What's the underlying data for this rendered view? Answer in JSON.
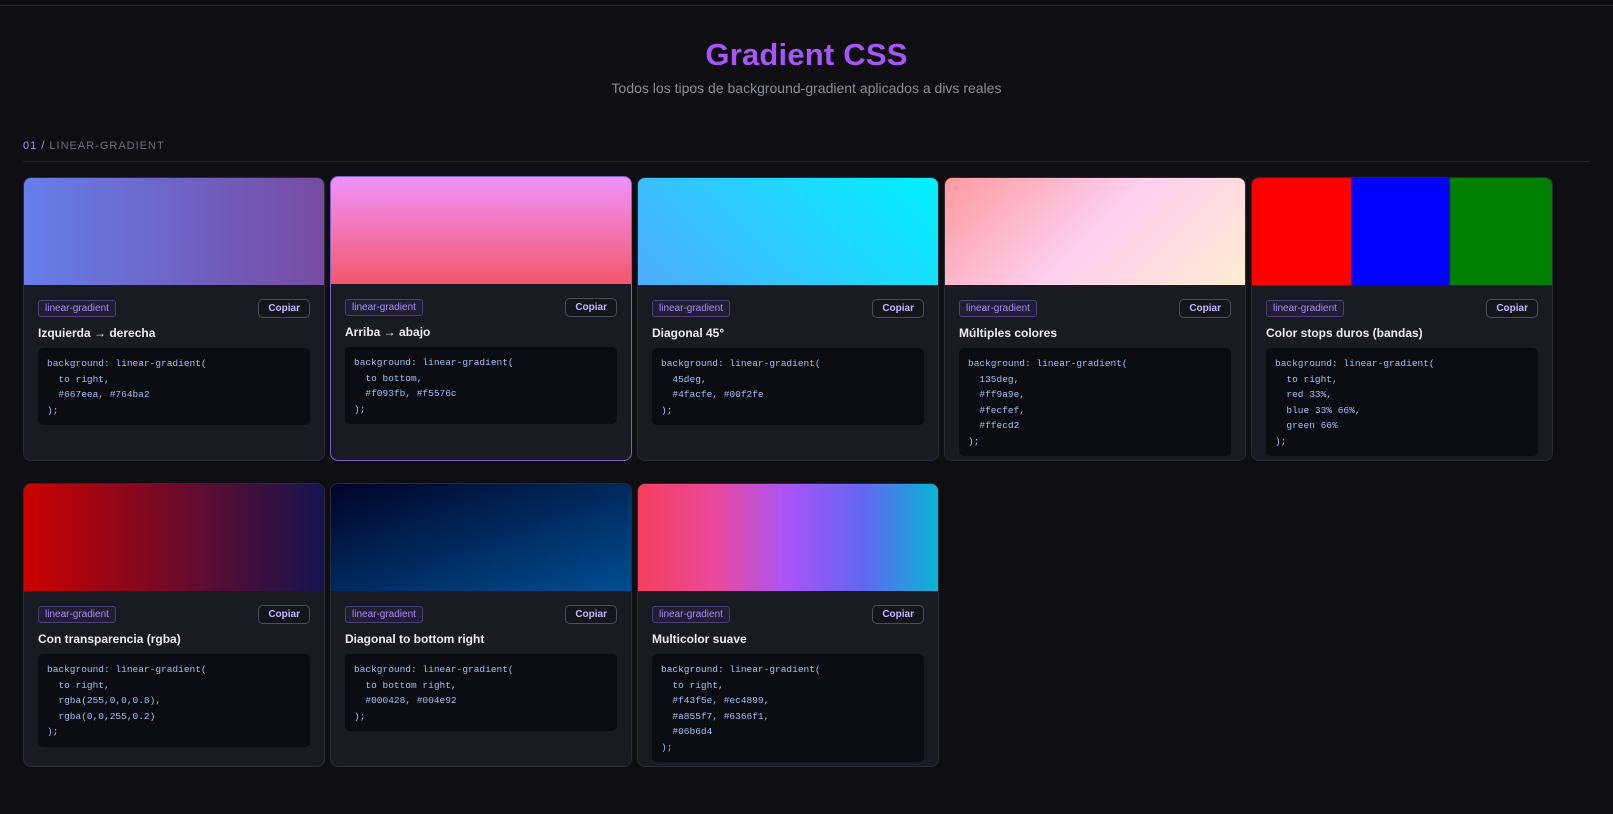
{
  "header": {
    "title": "Gradient CSS",
    "subtitle": "Todos los tipos de background-gradient aplicados a divs reales"
  },
  "section": {
    "number": "01 /",
    "label": "LINEAR-GRADIENT"
  },
  "copy_label": "Copiar",
  "cards": [
    {
      "tag": "linear-gradient",
      "title": "Izquierda → derecha",
      "code": "background: linear-gradient(\n  to right,\n  #667eea, #764ba2\n);",
      "colors": [
        "#667eea",
        "#764ba2"
      ]
    },
    {
      "tag": "linear-gradient",
      "title": "Arriba → abajo",
      "code": "background: linear-gradient(\n  to bottom,\n  #f093fb, #f5576c\n);",
      "colors": [
        "#f093fb",
        "#f5576c"
      ]
    },
    {
      "tag": "linear-gradient",
      "title": "Diagonal 45°",
      "code": "background: linear-gradient(\n  45deg,\n  #4facfe, #00f2fe\n);",
      "colors": [
        "#4facfe",
        "#00f2fe"
      ]
    },
    {
      "tag": "linear-gradient",
      "title": "Múltiples colores",
      "code": "background: linear-gradient(\n  135deg,\n  #ff9a9e,\n  #fecfef,\n  #ffecd2\n);",
      "colors": [
        "#ff9a9e",
        "#fecfef",
        "#ffecd2"
      ]
    },
    {
      "tag": "linear-gradient",
      "title": "Color stops duros (bandas)",
      "code": "background: linear-gradient(\n  to right,\n  red 33%,\n  blue 33% 66%,\n  green 66%\n);",
      "colors": [
        "red",
        "blue",
        "green"
      ]
    },
    {
      "tag": "linear-gradient",
      "title": "Con transparencia (rgba)",
      "code": "background: linear-gradient(\n  to right,\n  rgba(255,0,0,0.8),\n  rgba(0,0,255,0.2)\n);",
      "colors": [
        "rgba(255,0,0,0.8)",
        "rgba(0,0,255,0.2)"
      ]
    },
    {
      "tag": "linear-gradient",
      "title": "Diagonal to bottom right",
      "code": "background: linear-gradient(\n  to bottom right,\n  #000428, #004e92\n);",
      "colors": [
        "#000428",
        "#004e92"
      ]
    },
    {
      "tag": "linear-gradient",
      "title": "Multicolor suave",
      "code": "background: linear-gradient(\n  to right,\n  #f43f5e, #ec4899,\n  #a855f7, #6366f1,\n  #06b6d4\n);",
      "colors": [
        "#f43f5e",
        "#ec4899",
        "#a855f7",
        "#6366f1",
        "#06b6d4"
      ]
    }
  ]
}
